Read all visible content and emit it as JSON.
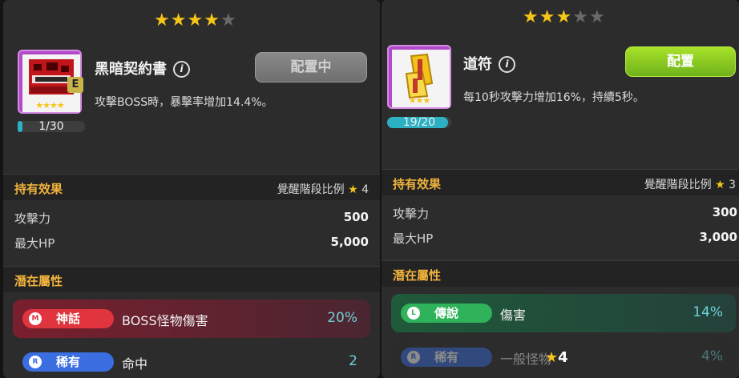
{
  "cards": [
    {
      "stars": {
        "filled": 4,
        "total": 5
      },
      "item_grade": "E",
      "counter": {
        "text": "1/30",
        "progress": 0.033
      },
      "name": "黑暗契約書",
      "description": "攻擊BOSS時，暴擊率增加14.4%。",
      "equip_button": "配置中",
      "equip_state": "disabled",
      "owned_effect": {
        "title": "持有效果",
        "ratio_label": "覺醒階段比例",
        "ratio_value": "4",
        "stats": [
          {
            "label": "攻擊力",
            "value": "500"
          },
          {
            "label": "最大HP",
            "value": "5,000"
          }
        ]
      },
      "potential": {
        "title": "潛在屬性",
        "rows": [
          {
            "grade": "神話",
            "option": "BOSS怪物傷害",
            "value": "20%",
            "color": "#e0353f"
          },
          {
            "grade": "稀有",
            "option": "命中",
            "value": "2",
            "color": "#3b6ee0"
          }
        ]
      }
    },
    {
      "stars": {
        "filled": 3,
        "total": 5
      },
      "counter": {
        "text": "19/20",
        "progress": 0.95
      },
      "name": "道符",
      "description": "每10秒攻擊力增加16%，持續5秒。",
      "equip_button": "配置",
      "equip_state": "active",
      "owned_effect": {
        "title": "持有效果",
        "ratio_label": "覺醒階段比例",
        "ratio_value": "3",
        "stats": [
          {
            "label": "攻擊力",
            "value": "300"
          },
          {
            "label": "最大HP",
            "value": "3,000"
          }
        ]
      },
      "potential": {
        "title": "潛在屬性",
        "rows": [
          {
            "grade": "傳說",
            "option": "傷害",
            "value": "14%",
            "color": "#2fb35a"
          },
          {
            "grade": "稀有",
            "option": "一般怪物",
            "value": "4%",
            "color": "#3b6ee0",
            "overlay_badge": "4"
          }
        ]
      }
    }
  ]
}
